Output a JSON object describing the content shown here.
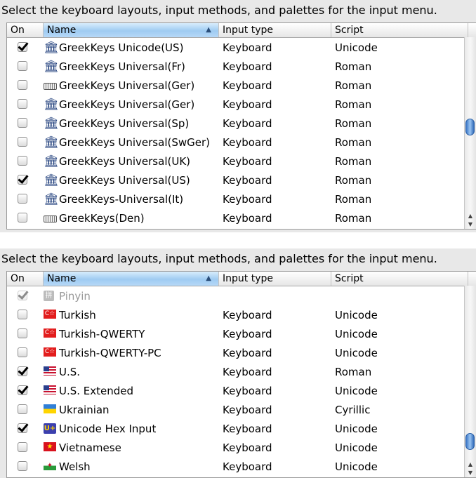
{
  "panels": [
    {
      "heading": "Select the keyboard layouts, input methods, and palettes for the input menu.",
      "columns": {
        "on": "On",
        "name": "Name",
        "type": "Input type",
        "script": "Script"
      },
      "rows": [
        {
          "on": true,
          "icon": "temple-icon",
          "name": "GreekKeys Unicode(US)",
          "type": "Keyboard",
          "script": "Unicode"
        },
        {
          "on": false,
          "icon": "temple-icon",
          "name": "GreekKeys Universal(Fr)",
          "type": "Keyboard",
          "script": "Roman"
        },
        {
          "on": false,
          "icon": "keyboard-icon",
          "name": "GreekKeys Universal(Ger)",
          "type": "Keyboard",
          "script": "Roman"
        },
        {
          "on": false,
          "icon": "temple-icon",
          "name": "GreekKeys Universal(Ger)",
          "type": "Keyboard",
          "script": "Roman"
        },
        {
          "on": false,
          "icon": "temple-icon",
          "name": "GreekKeys Universal(Sp)",
          "type": "Keyboard",
          "script": "Roman"
        },
        {
          "on": false,
          "icon": "temple-icon",
          "name": "GreekKeys Universal(SwGer)",
          "type": "Keyboard",
          "script": "Roman"
        },
        {
          "on": false,
          "icon": "temple-icon",
          "name": "GreekKeys Universal(UK)",
          "type": "Keyboard",
          "script": "Roman"
        },
        {
          "on": true,
          "icon": "temple-icon",
          "name": "GreekKeys Universal(US)",
          "type": "Keyboard",
          "script": "Roman"
        },
        {
          "on": false,
          "icon": "temple-icon",
          "name": "GreekKeys-Universal(It)",
          "type": "Keyboard",
          "script": "Roman"
        },
        {
          "on": false,
          "icon": "keyboard-icon",
          "name": "GreekKeys(Den)",
          "type": "Keyboard",
          "script": "Roman"
        }
      ]
    },
    {
      "heading": "Select the keyboard layouts, input methods, and palettes for the input menu.",
      "columns": {
        "on": "On",
        "name": "Name",
        "type": "Input type",
        "script": "Script"
      },
      "rows": [
        {
          "on": true,
          "dim": true,
          "icon": "pinyin-icon",
          "name": "Pinyin",
          "type": "",
          "script": ""
        },
        {
          "on": false,
          "icon": "turkey-flag-icon",
          "name": "Turkish",
          "type": "Keyboard",
          "script": "Unicode"
        },
        {
          "on": false,
          "icon": "turkey-flag-icon",
          "name": "Turkish-QWERTY",
          "type": "Keyboard",
          "script": "Unicode"
        },
        {
          "on": false,
          "icon": "turkey-flag-icon",
          "name": "Turkish-QWERTY-PC",
          "type": "Keyboard",
          "script": "Unicode"
        },
        {
          "on": true,
          "icon": "us-flag-icon",
          "name": "U.S.",
          "type": "Keyboard",
          "script": "Roman"
        },
        {
          "on": true,
          "icon": "us-flag-icon",
          "name": "U.S. Extended",
          "type": "Keyboard",
          "script": "Unicode"
        },
        {
          "on": false,
          "icon": "ukraine-flag-icon",
          "name": "Ukrainian",
          "type": "Keyboard",
          "script": "Cyrillic"
        },
        {
          "on": true,
          "icon": "unicode-hex-icon",
          "name": "Unicode Hex Input",
          "type": "Keyboard",
          "script": "Unicode"
        },
        {
          "on": false,
          "icon": "vietnam-flag-icon",
          "name": "Vietnamese",
          "type": "Keyboard",
          "script": "Unicode"
        },
        {
          "on": false,
          "icon": "wales-flag-icon",
          "name": "Welsh",
          "type": "Keyboard",
          "script": "Unicode"
        }
      ]
    }
  ]
}
